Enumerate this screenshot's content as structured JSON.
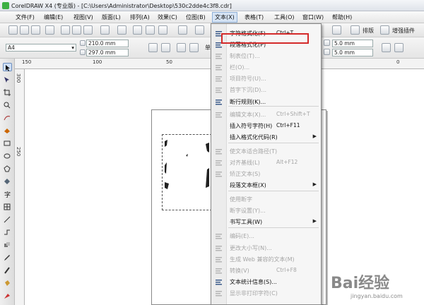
{
  "window": {
    "title": "CorelDRAW X4 (专业版) - [C:\\Users\\Administrator\\Desktop\\530c2dde4c3f8.cdr]"
  },
  "menubar": [
    {
      "label": "文件(F)"
    },
    {
      "label": "编辑(E)"
    },
    {
      "label": "视图(V)"
    },
    {
      "label": "版面(L)"
    },
    {
      "label": "排列(A)"
    },
    {
      "label": "效果(C)"
    },
    {
      "label": "位图(B)"
    },
    {
      "label": "文本(X)"
    },
    {
      "label": "表格(T)"
    },
    {
      "label": "工具(O)"
    },
    {
      "label": "窗口(W)"
    },
    {
      "label": "帮助(H)"
    }
  ],
  "toolbar": {
    "typesetting_label": "排版",
    "plugin_label": "增强插件"
  },
  "property_bar": {
    "page_size": "A4",
    "width": "210.0 mm",
    "height": "297.0 mm",
    "unit_label": "单",
    "nudge_x": "5.0 mm",
    "nudge_y": "5.0 mm"
  },
  "rulers": {
    "h": [
      "150",
      "100",
      "50",
      "0"
    ],
    "v": [
      "300",
      "250"
    ]
  },
  "text_menu": {
    "items": [
      {
        "label": "字符格式化(F)",
        "shortcut": "Ctrl+T",
        "enabled": true,
        "submenu": false,
        "icon": "character-format-icon"
      },
      {
        "label": "段落格式化(P)",
        "shortcut": "",
        "enabled": true,
        "submenu": false,
        "icon": "paragraph-format-icon"
      },
      {
        "label": "制表位(T)...",
        "shortcut": "",
        "enabled": false,
        "submenu": false,
        "icon": "tab-icon"
      },
      {
        "label": "栏(O)...",
        "shortcut": "",
        "enabled": false,
        "submenu": false,
        "icon": "columns-icon"
      },
      {
        "label": "项目符号(U)...",
        "shortcut": "",
        "enabled": false,
        "submenu": false,
        "icon": "bullets-icon"
      },
      {
        "label": "首字下沉(D)...",
        "shortcut": "",
        "enabled": false,
        "submenu": false,
        "icon": "drop-cap-icon"
      },
      {
        "label": "断行规则(K)...",
        "shortcut": "",
        "enabled": true,
        "submenu": false,
        "icon": "line-break-icon"
      },
      {
        "label": "编辑文本(X)...",
        "shortcut": "Ctrl+Shift+T",
        "enabled": false,
        "submenu": false,
        "icon": "edit-text-icon"
      },
      {
        "label": "插入符号字符(H)",
        "shortcut": "Ctrl+F11",
        "enabled": true,
        "submenu": false,
        "icon": ""
      },
      {
        "label": "插入格式化代码(R)",
        "shortcut": "",
        "enabled": true,
        "submenu": true,
        "icon": ""
      },
      {
        "label": "使文本适合路径(T)",
        "shortcut": "",
        "enabled": false,
        "submenu": false,
        "icon": "fit-text-path-icon"
      },
      {
        "label": "对齐基线(L)",
        "shortcut": "Alt+F12",
        "enabled": false,
        "submenu": false,
        "icon": "align-baseline-icon"
      },
      {
        "label": "矫正文本(S)",
        "shortcut": "",
        "enabled": false,
        "submenu": false,
        "icon": "straighten-text-icon"
      },
      {
        "label": "段落文本框(X)",
        "shortcut": "",
        "enabled": true,
        "submenu": true,
        "icon": ""
      },
      {
        "label": "使用断字",
        "shortcut": "",
        "enabled": false,
        "submenu": false,
        "icon": ""
      },
      {
        "label": "断字设置(Y)...",
        "shortcut": "",
        "enabled": false,
        "submenu": false,
        "icon": ""
      },
      {
        "label": "书写工具(W)",
        "shortcut": "",
        "enabled": true,
        "submenu": true,
        "icon": ""
      },
      {
        "label": "编码(E)...",
        "shortcut": "",
        "enabled": false,
        "submenu": false,
        "icon": "encoding-icon"
      },
      {
        "label": "更改大小写(N)...",
        "shortcut": "",
        "enabled": false,
        "submenu": false,
        "icon": "change-case-icon"
      },
      {
        "label": "生成 Web 兼容的文本(M)",
        "shortcut": "",
        "enabled": false,
        "submenu": false,
        "icon": "web-text-icon"
      },
      {
        "label": "转换(V)",
        "shortcut": "Ctrl+F8",
        "enabled": false,
        "submenu": false,
        "icon": "convert-icon"
      },
      {
        "label": "文本统计信息(S)...",
        "shortcut": "",
        "enabled": true,
        "submenu": false,
        "icon": "text-stats-icon"
      },
      {
        "label": "显示非打印字符(C)",
        "shortcut": "",
        "enabled": false,
        "submenu": false,
        "icon": "nonprint-chars-icon"
      }
    ]
  },
  "watermark": {
    "text": "Bai经验",
    "sub": "jingyan.baidu.com"
  },
  "colors": {
    "highlight_box": "#d42a2a",
    "menu_active": "#d6e4f5"
  }
}
